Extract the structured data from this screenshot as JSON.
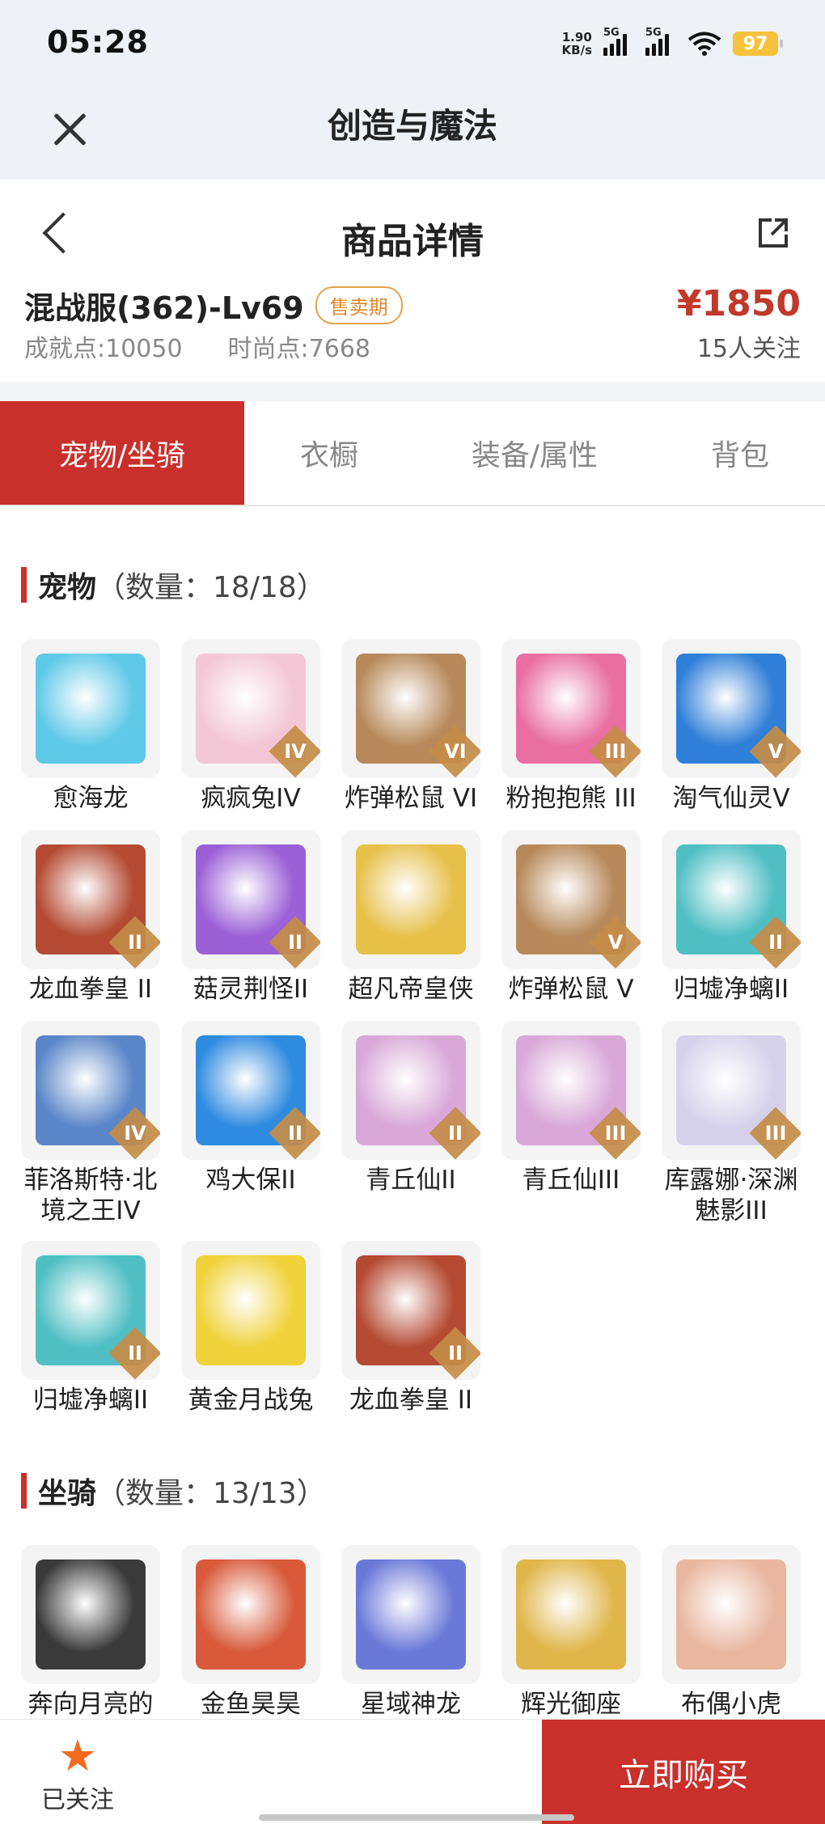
{
  "status_bar": {
    "time": "05:28",
    "net_speed_value": "1.90",
    "net_speed_unit": "KB/s",
    "signal1_label": "5G",
    "signal2_label": "5G",
    "battery": "97"
  },
  "app_title": "创造与魔法",
  "header": {
    "page_title": "商品详情",
    "server_level": "混战服(362)-Lv69",
    "status_badge": "售卖期",
    "achievement_label": "成就点:",
    "achievement_value": "10050",
    "fashion_label": "时尚点:",
    "fashion_value": "7668",
    "price": "¥1850",
    "followers": "15人关注"
  },
  "tabs": [
    "宠物/坐骑",
    "衣橱",
    "装备/属性",
    "背包"
  ],
  "pets_section": {
    "title": "宠物",
    "count": "（数量：18/18）",
    "items": [
      {
        "name": "愈海龙",
        "tier": "",
        "color": "#5fc9e8"
      },
      {
        "name": "疯疯兔IV",
        "tier": "IV",
        "color": "#f3c7d6"
      },
      {
        "name": "炸弹松鼠 VI",
        "tier": "VI",
        "color": "#b7895a"
      },
      {
        "name": "粉抱抱熊 III",
        "tier": "III",
        "color": "#e86fa0"
      },
      {
        "name": "淘气仙灵V",
        "tier": "V",
        "color": "#2f7fd8"
      },
      {
        "name": "龙血拳皇 II",
        "tier": "II",
        "color": "#b44a32"
      },
      {
        "name": "菇灵荆怪II",
        "tier": "II",
        "color": "#9b5fd6"
      },
      {
        "name": "超凡帝皇侠",
        "tier": "",
        "color": "#e7c04a"
      },
      {
        "name": "炸弹松鼠 V",
        "tier": "V",
        "color": "#b7895a"
      },
      {
        "name": "归墟净螭II",
        "tier": "II",
        "color": "#4fbfc4"
      },
      {
        "name": "菲洛斯特·北境之王IV",
        "tier": "IV",
        "color": "#5a86c9"
      },
      {
        "name": "鸡大保II",
        "tier": "II",
        "color": "#2f8be0"
      },
      {
        "name": "青丘仙II",
        "tier": "II",
        "color": "#d9a8d8"
      },
      {
        "name": "青丘仙III",
        "tier": "III",
        "color": "#d9a8d8"
      },
      {
        "name": "库露娜·深渊魅影III",
        "tier": "III",
        "color": "#d7d2ec"
      },
      {
        "name": "归墟净螭II",
        "tier": "II",
        "color": "#4fbfc4"
      },
      {
        "name": "黄金月战兔",
        "tier": "",
        "color": "#f0d23a"
      },
      {
        "name": "龙血拳皇 II",
        "tier": "II",
        "color": "#b44a32"
      }
    ]
  },
  "mounts_section": {
    "title": "坐骑",
    "count": "（数量：13/13）",
    "items": [
      {
        "name": "奔向月亮的",
        "tier": "",
        "color": "#3a3a3a"
      },
      {
        "name": "金鱼昊昊",
        "tier": "",
        "color": "#d85a3a"
      },
      {
        "name": "星域神龙",
        "tier": "",
        "color": "#6a78d8"
      },
      {
        "name": "辉光御座",
        "tier": "",
        "color": "#e0b64a"
      },
      {
        "name": "布偶小虎",
        "tier": "",
        "color": "#e9b7a0"
      }
    ]
  },
  "bottom": {
    "follow_label": "已关注",
    "buy_label": "立即购买"
  },
  "colors": {
    "accent": "#c9302c",
    "price": "#c0392b",
    "badge": "#e0892c",
    "star": "#f36b21"
  }
}
